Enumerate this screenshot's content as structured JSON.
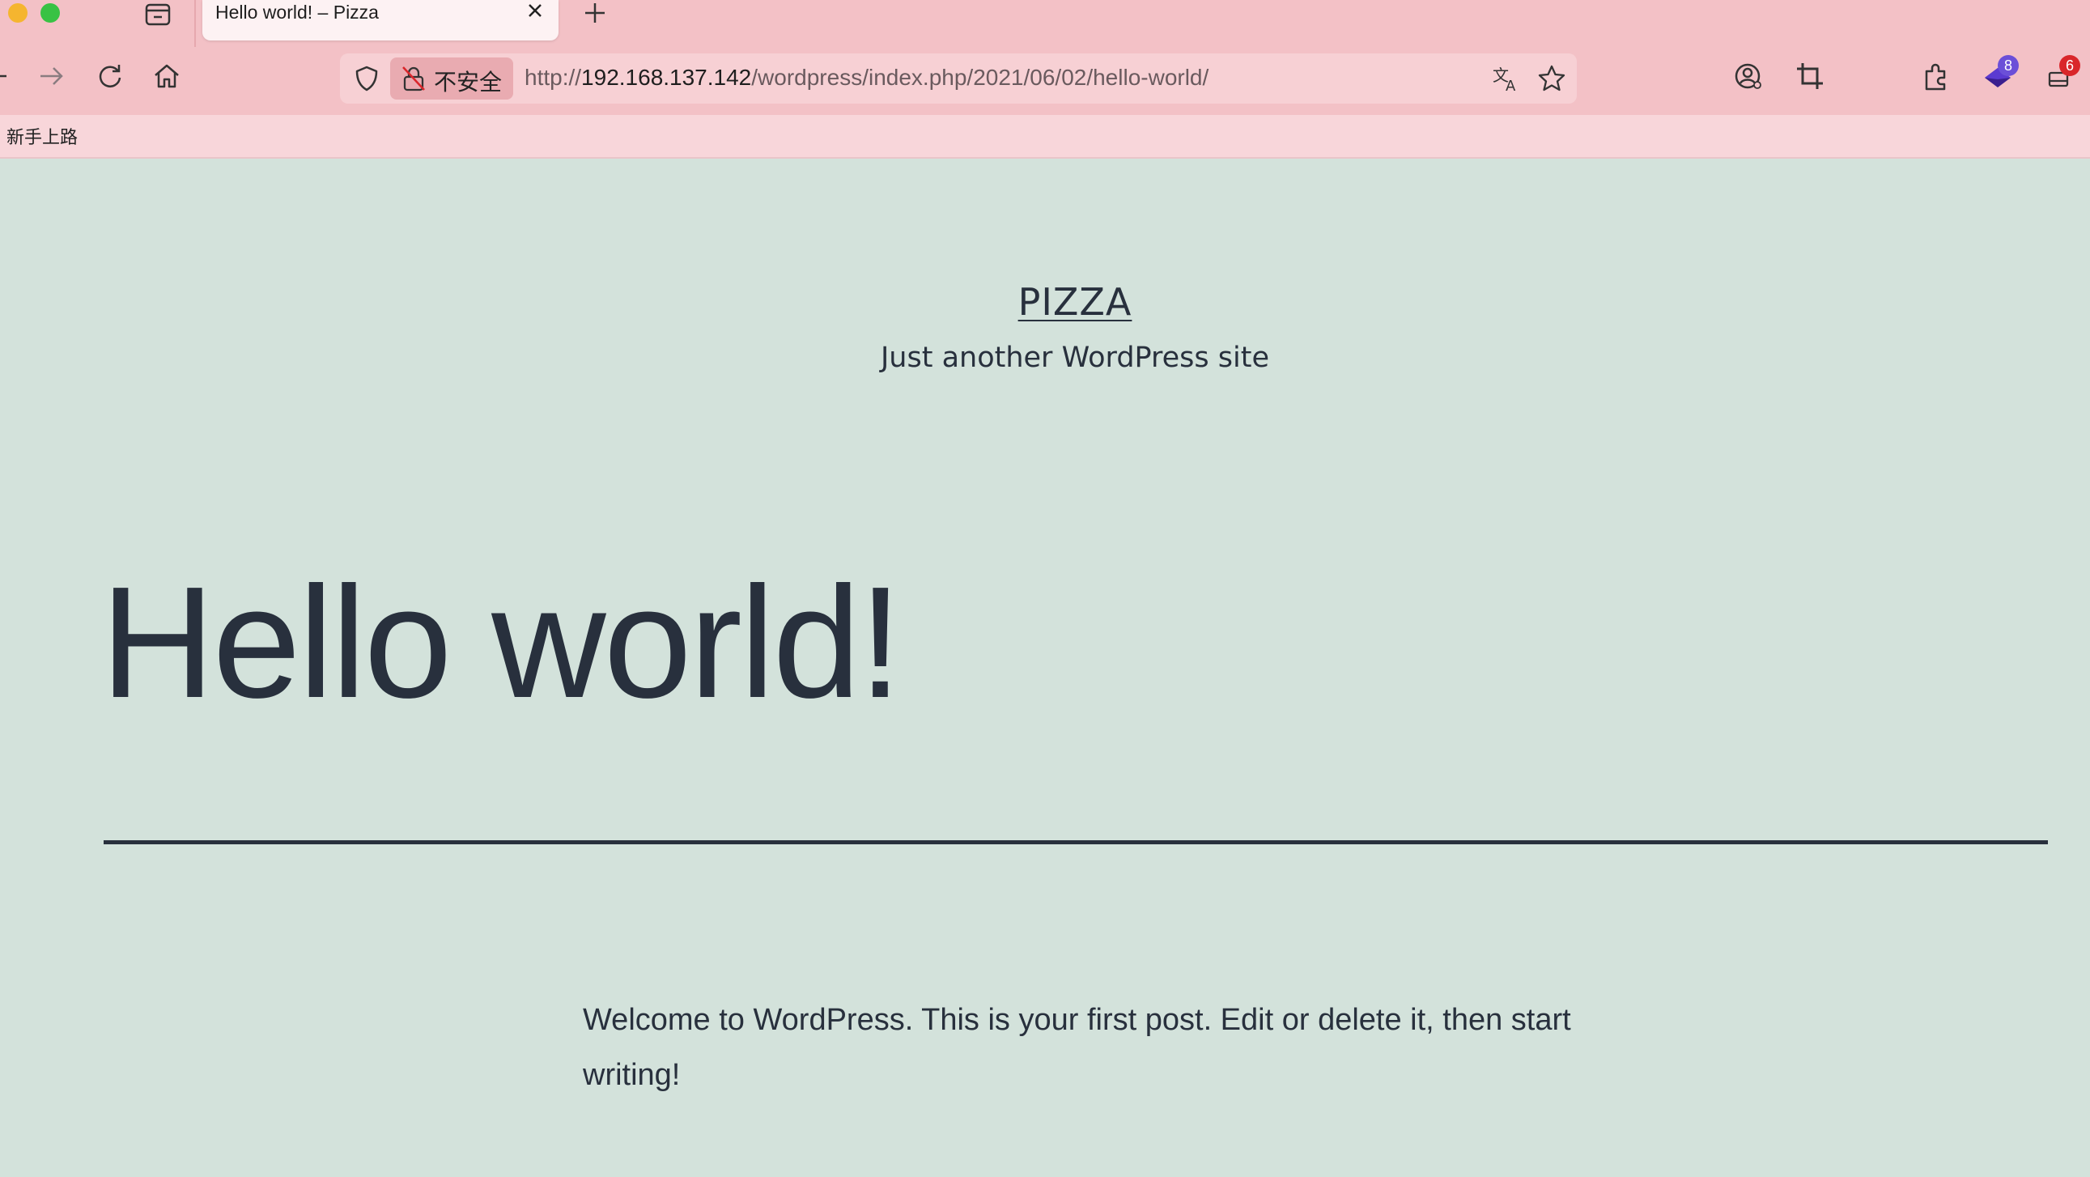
{
  "browser": {
    "tab": {
      "title": "Hello world! – Pizza"
    },
    "urlbar": {
      "security_label": "不安全",
      "url_scheme": "http://",
      "url_host": "192.168.137.142",
      "url_path": "/wordpress/index.php/2021/06/02/hello-world/"
    },
    "extension_badges": {
      "extension_a": "8",
      "extension_b": "6"
    },
    "bookmarks": [
      {
        "label": "新手上路"
      }
    ]
  },
  "page": {
    "site_title": "PIZZA",
    "site_description": "Just another WordPress site",
    "post_title": "Hello world!",
    "post_content": "Welcome to WordPress. This is your first post. Edit or delete it, then start writing!"
  },
  "colors": {
    "chrome_bg": "#f3c1c6",
    "page_bg": "#d3e2db",
    "text": "#28303d",
    "badge_purple": "#6b4fd8",
    "badge_red": "#d9262a"
  }
}
